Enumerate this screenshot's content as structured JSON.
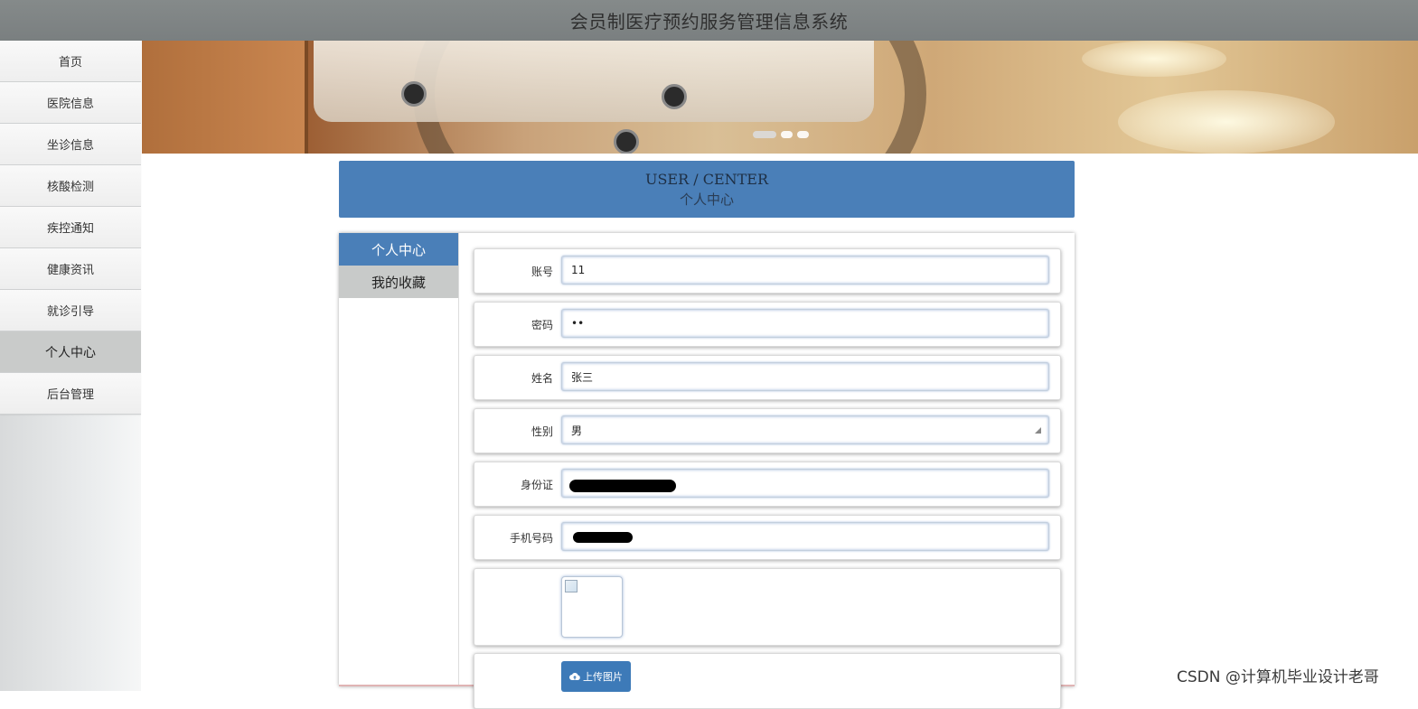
{
  "header": {
    "title": "会员制医疗预约服务管理信息系统"
  },
  "sidebar": {
    "items": [
      {
        "label": "首页"
      },
      {
        "label": "医院信息"
      },
      {
        "label": "坐诊信息"
      },
      {
        "label": "核酸检测"
      },
      {
        "label": "疾控通知"
      },
      {
        "label": "健康资讯"
      },
      {
        "label": "就诊引导"
      },
      {
        "label": "个人中心",
        "active": true
      },
      {
        "label": "后台管理"
      }
    ]
  },
  "banner": {
    "slides": 3,
    "active_slide": 1
  },
  "user_center": {
    "title_en": "USER / CENTER",
    "title_cn": "个人中心"
  },
  "tabs": [
    {
      "label": "个人中心",
      "active": true
    },
    {
      "label": "我的收藏",
      "active": false
    }
  ],
  "form": {
    "account": {
      "label": "账号",
      "value": "11"
    },
    "password": {
      "label": "密码",
      "value": "••"
    },
    "name": {
      "label": "姓名",
      "value": "张三"
    },
    "gender": {
      "label": "性别",
      "value": "男"
    },
    "id_card": {
      "label": "身份证",
      "value": ""
    },
    "phone": {
      "label": "手机号码",
      "value": ""
    },
    "upload_label": "上传图片"
  },
  "watermark": "CSDN @计算机毕业设计老哥",
  "colors": {
    "accent": "#4a7fb8",
    "topbar": "#80858 6"
  }
}
